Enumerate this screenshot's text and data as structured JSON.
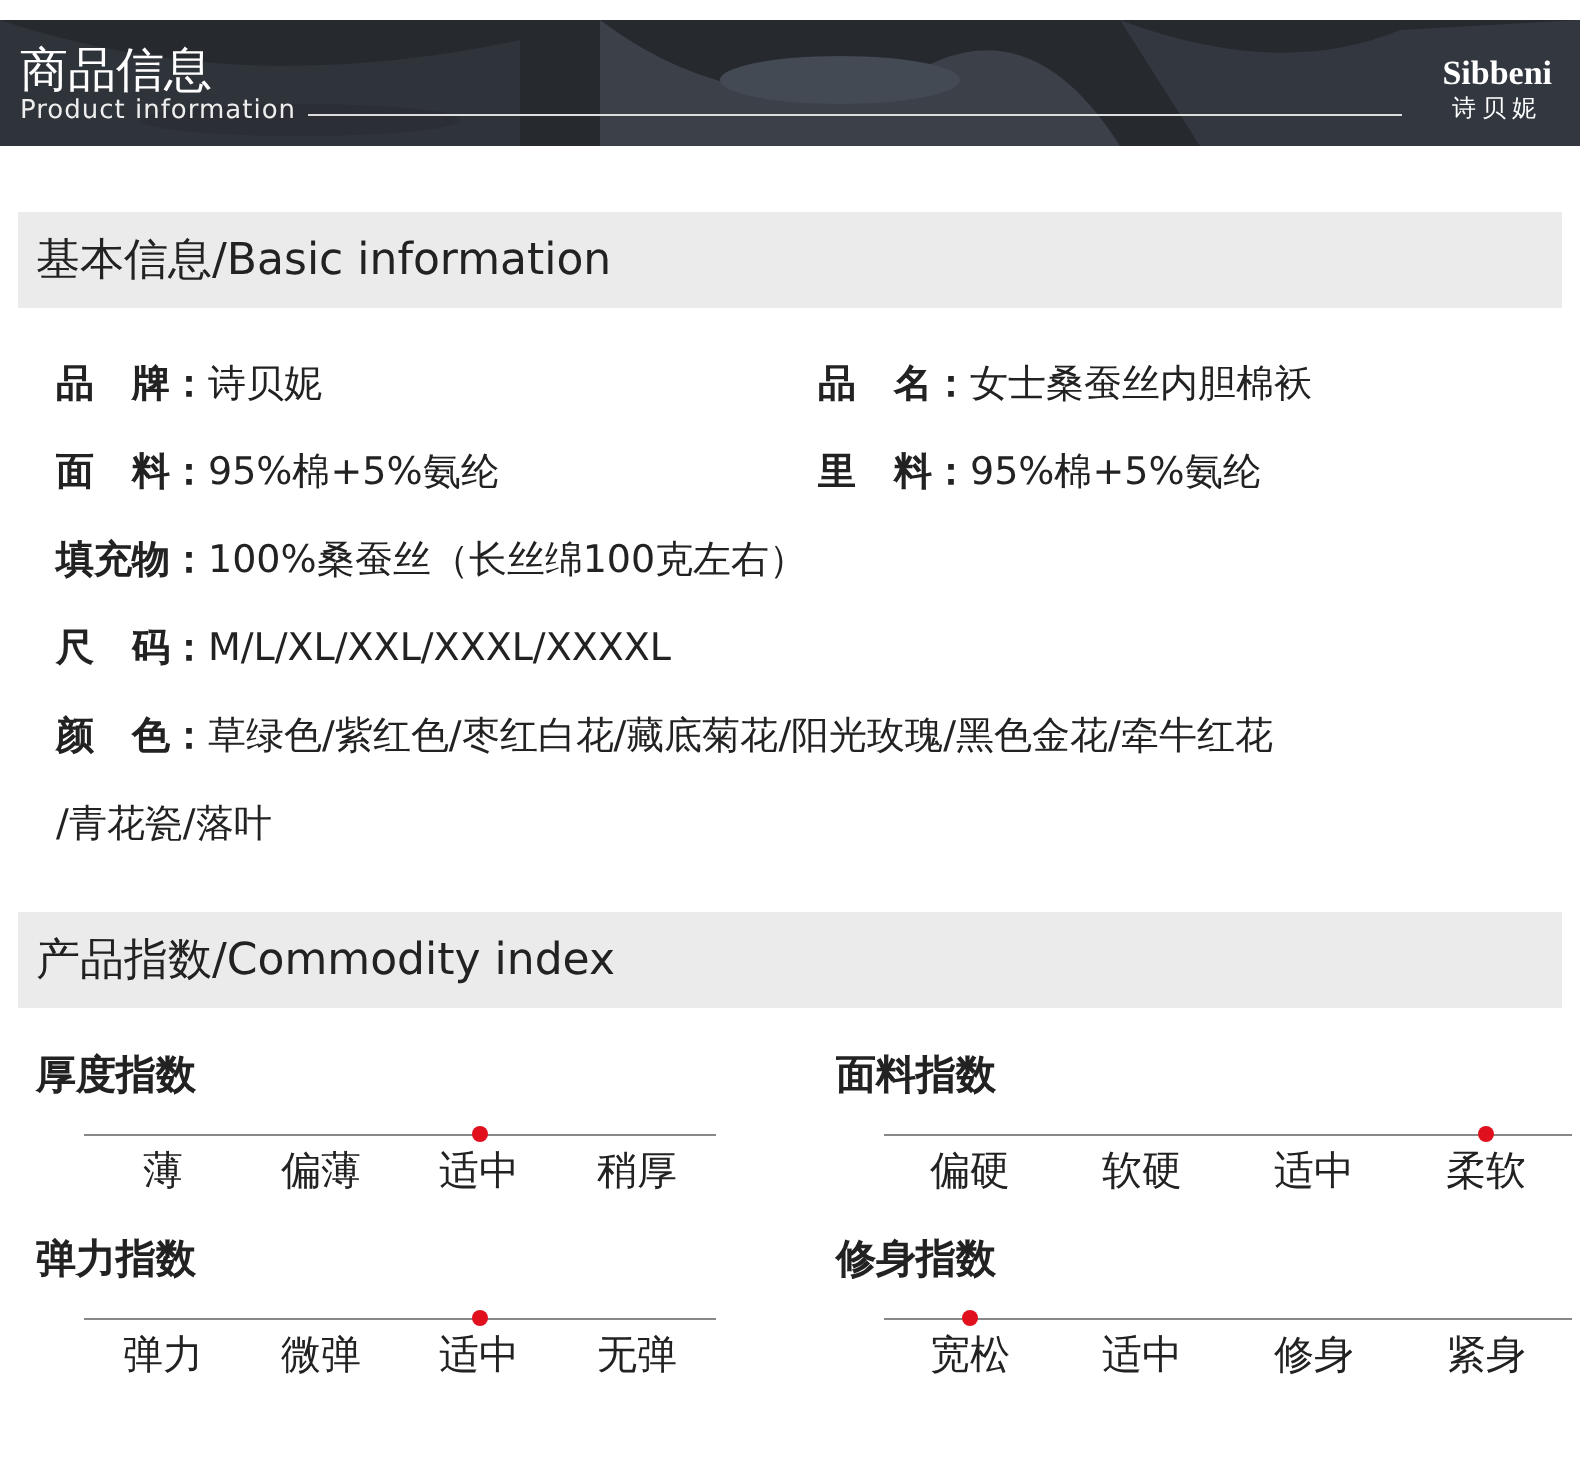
{
  "header": {
    "title": "商品信息",
    "subtitle": "Product information",
    "brand": "Sibbeni",
    "brand_cn": "诗贝妮"
  },
  "basic": {
    "title": "基本信息/Basic information",
    "rows": [
      [
        {
          "label": "品　牌：",
          "value": "诗贝妮"
        },
        {
          "label": "品　名：",
          "value": "女士桑蚕丝内胆棉袄"
        }
      ],
      [
        {
          "label": "面　料：",
          "value": "95%棉+5%氨纶"
        },
        {
          "label": "里　料：",
          "value": "95%棉+5%氨纶"
        }
      ],
      [
        {
          "label": "填充物：",
          "value": "100%桑蚕丝（长丝绵100克左右）"
        }
      ],
      [
        {
          "label": "尺　码：",
          "value": "M/L/XL/XXL/XXXL/XXXXL"
        }
      ],
      [
        {
          "label": "颜　色：",
          "lines": [
            "草绿色/紫红色/枣红白花/藏底菊花/阳光玫瑰/黑色金花/牵牛红花",
            "/青花瓷/落叶"
          ]
        }
      ]
    ]
  },
  "index": {
    "title": "产品指数/Commodity index",
    "scales": [
      {
        "name": "厚度指数",
        "options": [
          {
            "label": "薄",
            "selected": false
          },
          {
            "label": "偏薄",
            "selected": false
          },
          {
            "label": "适中",
            "selected": true
          },
          {
            "label": "稍厚",
            "selected": false
          }
        ]
      },
      {
        "name": "面料指数",
        "options": [
          {
            "label": "偏硬",
            "selected": false
          },
          {
            "label": "软硬",
            "selected": false
          },
          {
            "label": "适中",
            "selected": false
          },
          {
            "label": "柔软",
            "selected": true
          }
        ]
      },
      {
        "name": "弹力指数",
        "options": [
          {
            "label": "弹力",
            "selected": false
          },
          {
            "label": "微弹",
            "selected": false
          },
          {
            "label": "适中",
            "selected": true
          },
          {
            "label": "无弹",
            "selected": false
          }
        ]
      },
      {
        "name": "修身指数",
        "options": [
          {
            "label": "宽松",
            "selected": true
          },
          {
            "label": "适中",
            "selected": false
          },
          {
            "label": "修身",
            "selected": false
          },
          {
            "label": "紧身",
            "selected": false
          }
        ]
      }
    ]
  }
}
